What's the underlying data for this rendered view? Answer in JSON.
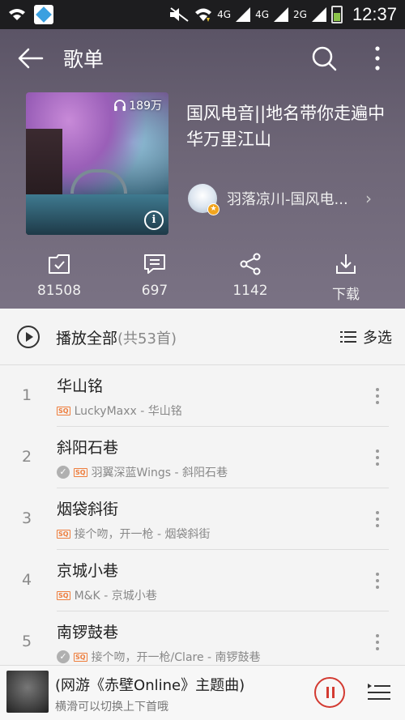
{
  "status_bar": {
    "clock": "12:37",
    "network_1": "4G",
    "network_2": "4G",
    "network_3": "2G",
    "icons": [
      "wifi-icon",
      "app-icon",
      "mute-icon",
      "wifi-icon",
      "signal-icon",
      "battery-icon"
    ]
  },
  "header": {
    "title": "歌单",
    "back_icon": "arrow-left-icon",
    "search_icon": "search-icon",
    "more_icon": "more-vertical-icon"
  },
  "playlist": {
    "play_count": "189万",
    "title": "国风电音||地名带你走遍中华万里江山",
    "creator": "羽落凉川-国风电..."
  },
  "actions": [
    {
      "icon": "favorite-folder-icon",
      "label": "81508"
    },
    {
      "icon": "comment-icon",
      "label": "697"
    },
    {
      "icon": "share-icon",
      "label": "1142"
    },
    {
      "icon": "download-icon",
      "label": "下载"
    }
  ],
  "play_all": {
    "label": "播放全部",
    "count": "(共53首)",
    "multi_select": "多选"
  },
  "songs": [
    {
      "index": "1",
      "title": "华山铭",
      "meta": "LuckyMaxx - 华山铭",
      "downloaded": false,
      "quality": "SQ"
    },
    {
      "index": "2",
      "title": "斜阳石巷",
      "meta": "羽翼深蓝Wings - 斜阳石巷",
      "downloaded": true,
      "quality": "SQ"
    },
    {
      "index": "3",
      "title": "烟袋斜街",
      "meta": "接个吻，开一枪 - 烟袋斜街",
      "downloaded": false,
      "quality": "SQ"
    },
    {
      "index": "4",
      "title": "京城小巷",
      "meta": "M&K - 京城小巷",
      "downloaded": false,
      "quality": "SQ"
    },
    {
      "index": "5",
      "title": "南锣鼓巷",
      "meta": "接个吻，开一枪/Clare - 南锣鼓巷",
      "downloaded": true,
      "quality": "SQ"
    }
  ],
  "player": {
    "title": "(网游《赤壁Online》主题曲)",
    "hint": "横滑可以切换上下首哦"
  },
  "colors": {
    "header_bg": "#6e6677",
    "accent_red": "#d33a31",
    "sq_orange": "#ee7d3c"
  }
}
